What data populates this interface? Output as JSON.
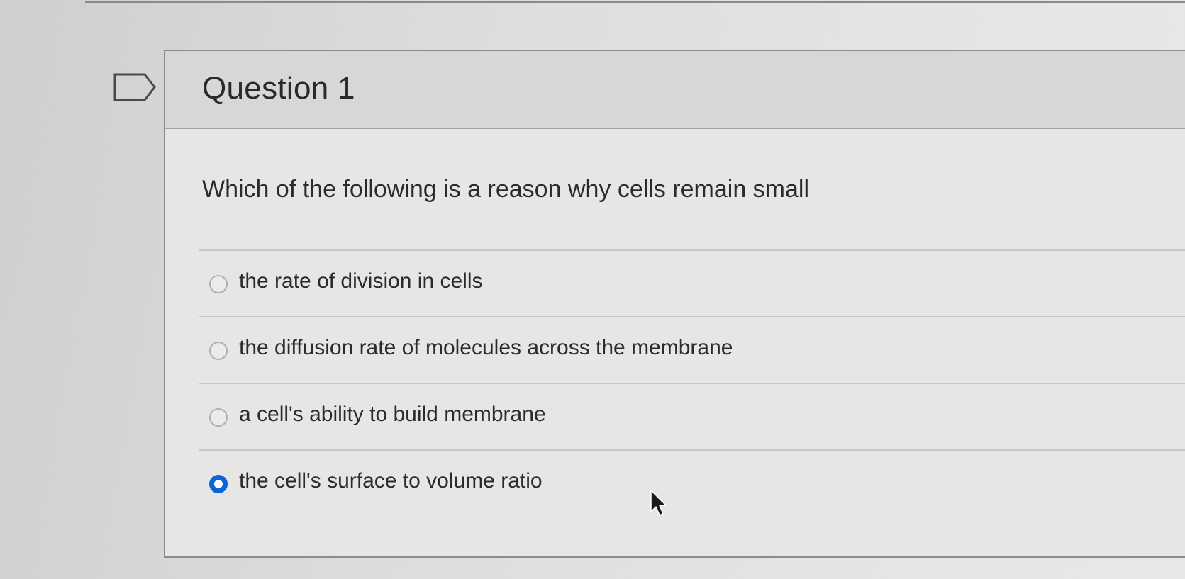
{
  "question": {
    "title": "Question 1",
    "text": "Which of the following is a reason why cells remain small",
    "answers": [
      {
        "label": "the rate of division in cells",
        "selected": false
      },
      {
        "label": "the diffusion rate of molecules across the membrane",
        "selected": false
      },
      {
        "label": "a cell's ability to build membrane",
        "selected": false
      },
      {
        "label": "the cell's surface to volume ratio",
        "selected": true
      }
    ]
  },
  "icons": {
    "flag": "flag-question-icon",
    "radio": "radio-button-icon",
    "cursor": "mouse-pointer-icon"
  },
  "colors": {
    "selected_radio": "#0a66d8",
    "header_background": "#d7d7d5",
    "text": "#2b2b2b"
  }
}
